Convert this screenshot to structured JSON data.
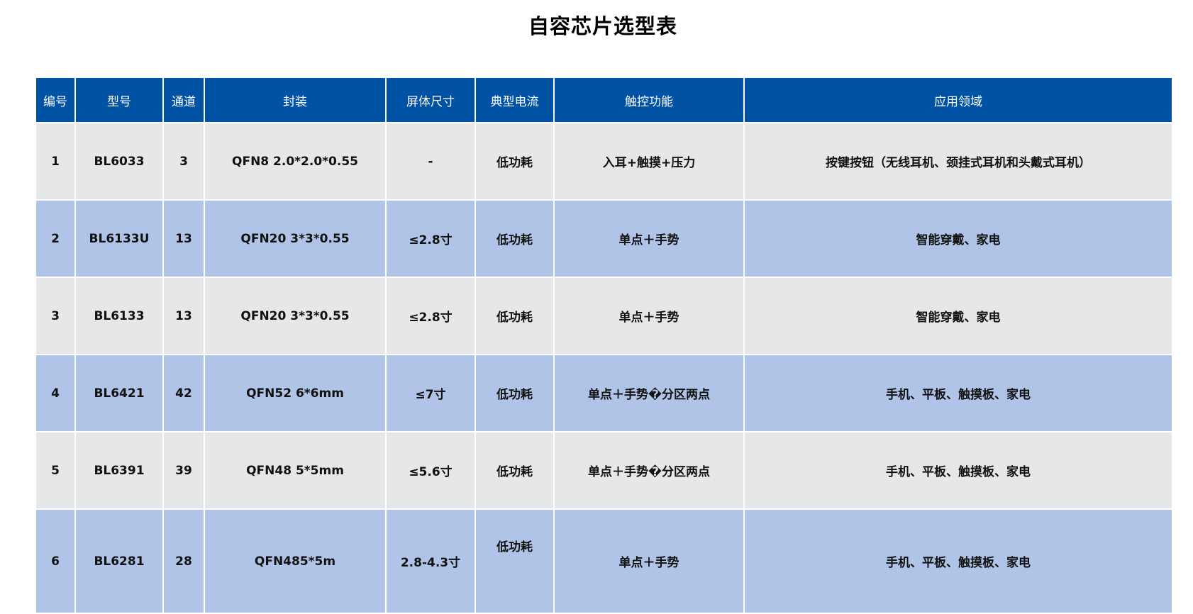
{
  "title": "自容芯片选型表",
  "colors": {
    "header_bg": "#0052a5",
    "row_odd_bg": "#e6e7e8",
    "row_even_bg": "#b0c4e8"
  },
  "table": {
    "headers": [
      "编号",
      "型号",
      "通道",
      "封装",
      "屏体尺寸",
      "典型电流",
      "触控功能",
      "应用领域"
    ],
    "rows": [
      [
        "1",
        "BL6033",
        "3",
        "QFN8 2.0*2.0*0.55",
        "-",
        "低功耗",
        "入耳+触摸+压力",
        "按键按钮（无线耳机、颈挂式耳机和头戴式耳机）"
      ],
      [
        "2",
        "BL6133U",
        "13",
        "QFN20 3*3*0.55",
        "≤2.8寸",
        "低功耗",
        "单点＋手势",
        "智能穿戴、家电"
      ],
      [
        "3",
        "BL6133",
        "13",
        "QFN20 3*3*0.55",
        "≤2.8寸",
        "低功耗",
        "单点＋手势",
        "智能穿戴、家电"
      ],
      [
        "4",
        "BL6421",
        "42",
        "QFN52 6*6mm",
        "≤7寸",
        "低功耗",
        "单点＋手势�分区两点",
        "手机、平板、触摸板、家电"
      ],
      [
        "5",
        "BL6391",
        "39",
        "QFN48 5*5mm",
        "≤5.6寸",
        "低功耗",
        "单点＋手势�分区两点",
        "手机、平板、触摸板、家电"
      ],
      [
        "6",
        "BL6281",
        "28",
        "QFN485*5m",
        "2.8-4.3寸",
        "低功耗",
        "单点＋手势",
        "手机、平板、触摸板、家电"
      ]
    ]
  }
}
